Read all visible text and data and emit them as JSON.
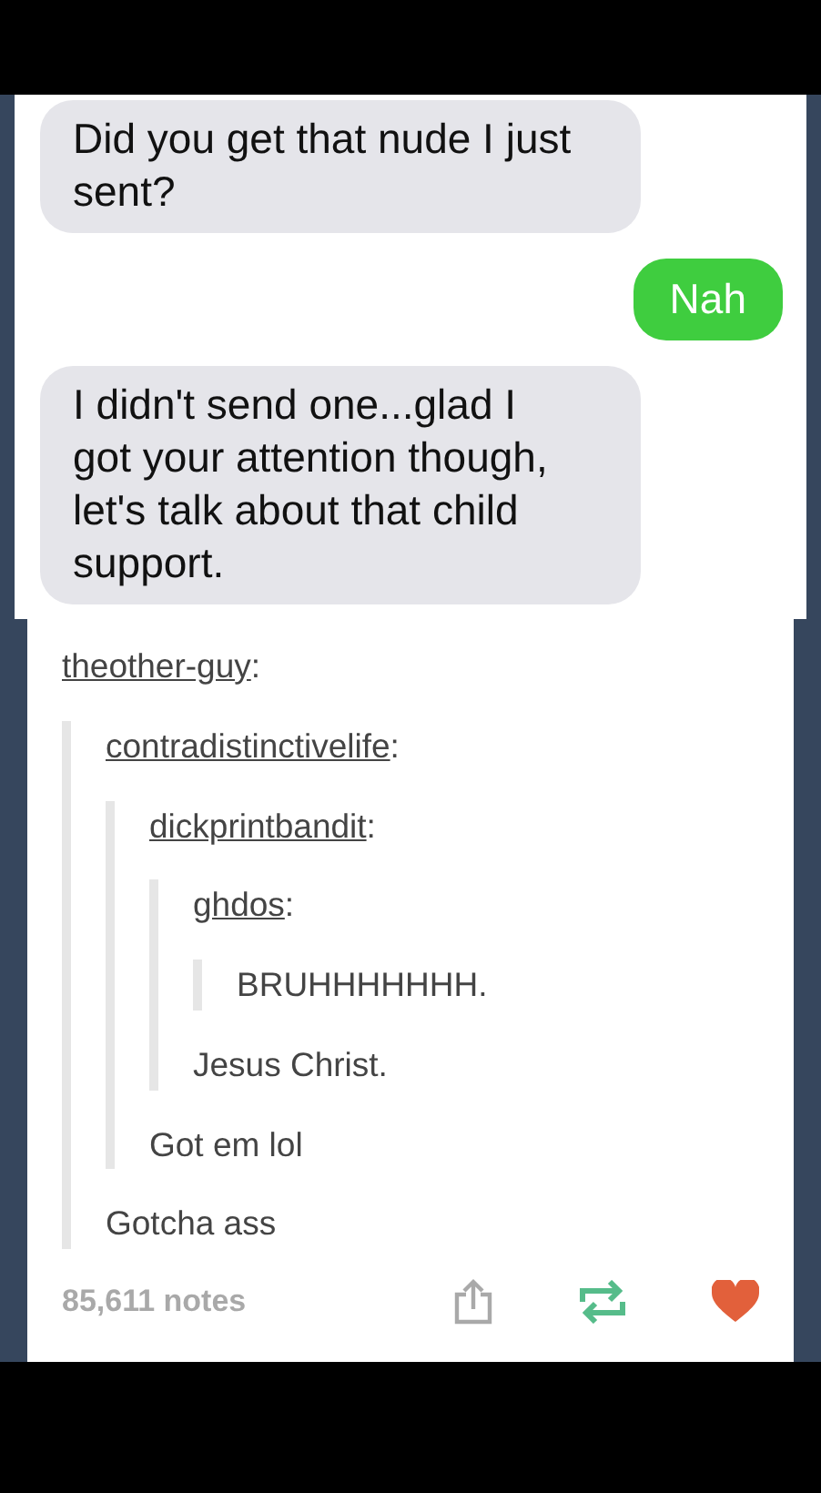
{
  "messages": [
    {
      "kind": "received",
      "text": "Did you get that nude I just sent?"
    },
    {
      "kind": "sent",
      "text": "Nah"
    },
    {
      "kind": "received",
      "text": "I didn't send one...glad I got your attention though, let's talk about that child support."
    }
  ],
  "post": {
    "thread": {
      "user": "theother-guy",
      "separator": ":",
      "children": [
        {
          "user": "contradistinctivelife",
          "separator": ":",
          "text": "Gotcha ass",
          "children": [
            {
              "user": "dickprintbandit",
              "separator": ":",
              "text": "Got em lol",
              "children": [
                {
                  "user": "ghdos",
                  "separator": ":",
                  "text": "Jesus Christ.",
                  "children": [
                    {
                      "text": "BRUHHHHHHH."
                    }
                  ]
                }
              ]
            }
          ]
        }
      ]
    },
    "notes": "85,611 notes",
    "liked": true
  }
}
